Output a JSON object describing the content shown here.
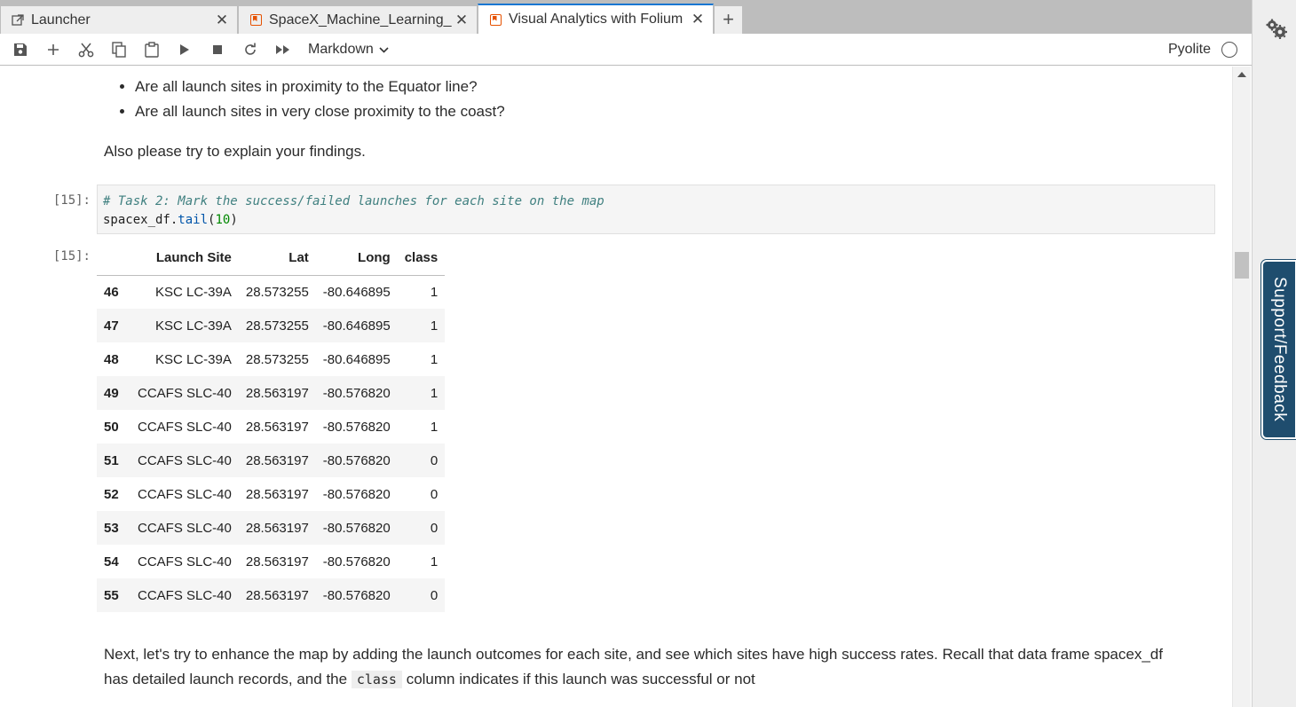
{
  "tabs": [
    {
      "label": "Launcher",
      "icon": "launcher-icon",
      "active": false
    },
    {
      "label": "SpaceX_Machine_Learning_P",
      "icon": "notebook-icon",
      "active": false
    },
    {
      "label": "Visual Analytics with Folium I",
      "icon": "notebook-icon",
      "active": true
    }
  ],
  "toolbar": {
    "cell_type": "Markdown",
    "kernel": "Pyolite"
  },
  "support": {
    "label": "Support/Feedback"
  },
  "notebook": {
    "questions": [
      "Are all launch sites in proximity to the Equator line?",
      "Are all launch sites in very close proximity to the coast?"
    ],
    "explain": "Also please try to explain your findings.",
    "code_prompt": "[15]:",
    "code": {
      "comment": "# Task 2: Mark the success/failed launches for each site on the map",
      "obj": "spacex_df.",
      "fn": "tail",
      "open": "(",
      "arg": "10",
      "close": ")"
    },
    "output_prompt": "[15]:",
    "table": {
      "columns": [
        "",
        "Launch Site",
        "Lat",
        "Long",
        "class"
      ],
      "rows": [
        [
          "46",
          "KSC LC-39A",
          "28.573255",
          "-80.646895",
          "1"
        ],
        [
          "47",
          "KSC LC-39A",
          "28.573255",
          "-80.646895",
          "1"
        ],
        [
          "48",
          "KSC LC-39A",
          "28.573255",
          "-80.646895",
          "1"
        ],
        [
          "49",
          "CCAFS SLC-40",
          "28.563197",
          "-80.576820",
          "1"
        ],
        [
          "50",
          "CCAFS SLC-40",
          "28.563197",
          "-80.576820",
          "1"
        ],
        [
          "51",
          "CCAFS SLC-40",
          "28.563197",
          "-80.576820",
          "0"
        ],
        [
          "52",
          "CCAFS SLC-40",
          "28.563197",
          "-80.576820",
          "0"
        ],
        [
          "53",
          "CCAFS SLC-40",
          "28.563197",
          "-80.576820",
          "0"
        ],
        [
          "54",
          "CCAFS SLC-40",
          "28.563197",
          "-80.576820",
          "1"
        ],
        [
          "55",
          "CCAFS SLC-40",
          "28.563197",
          "-80.576820",
          "0"
        ]
      ]
    },
    "next_para": {
      "part1": "Next, let's try to enhance the map by adding the launch outcomes for each site, and see which sites have high success rates. Recall that data frame spacex_df",
      "part2": "has detailed launch records, and the",
      "code": "class",
      "part3": "column indicates if this launch was successful or not"
    }
  }
}
